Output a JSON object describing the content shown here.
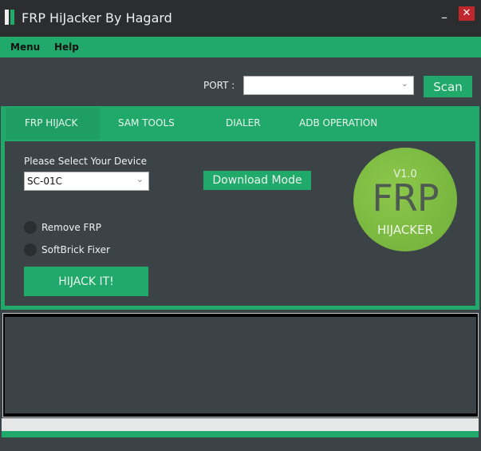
{
  "window": {
    "title": "FRP HiJacker By Hagard",
    "minimize": "–",
    "close": "✕",
    "colors": {
      "accent": "#21a86b",
      "background": "#3c4346",
      "close": "#c0272d"
    }
  },
  "menu": {
    "items": [
      "Menu",
      "Help"
    ]
  },
  "port": {
    "label": "PORT :",
    "value": "",
    "scan": "Scan"
  },
  "tabs": [
    "FRP HIJACK",
    "SAM TOOLS",
    "DIALER",
    "ADB OPERATION"
  ],
  "frp": {
    "device_label": "Please Select Your Device",
    "device_value": "SC-01C",
    "download_mode": "Download Mode",
    "options": [
      "Remove FRP",
      "SoftBrick Fixer"
    ],
    "hijack": "HIJACK IT!"
  },
  "logo": {
    "version": "V1.0",
    "big": "FRP",
    "small": "HIJACKER"
  },
  "progress": {
    "value": 0
  }
}
